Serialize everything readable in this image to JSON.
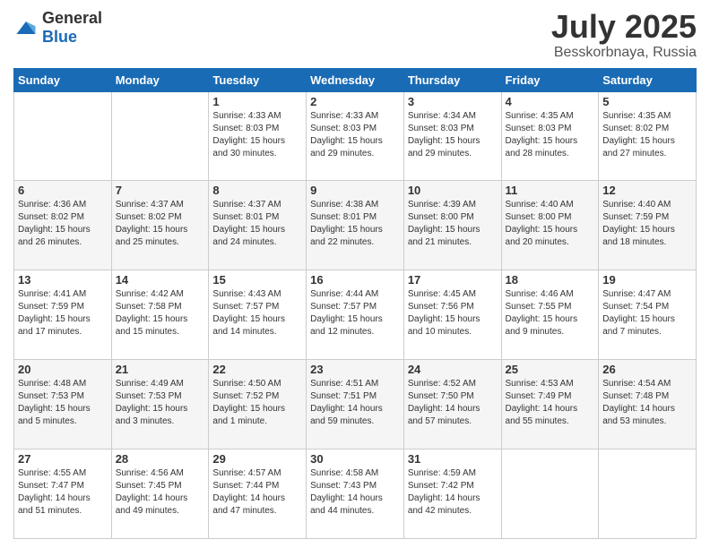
{
  "header": {
    "logo_general": "General",
    "logo_blue": "Blue",
    "title": "July 2025",
    "subtitle": "Besskorbnaya, Russia"
  },
  "weekdays": [
    "Sunday",
    "Monday",
    "Tuesday",
    "Wednesday",
    "Thursday",
    "Friday",
    "Saturday"
  ],
  "weeks": [
    [
      {
        "day": "",
        "info": ""
      },
      {
        "day": "",
        "info": ""
      },
      {
        "day": "1",
        "info": "Sunrise: 4:33 AM\nSunset: 8:03 PM\nDaylight: 15 hours\nand 30 minutes."
      },
      {
        "day": "2",
        "info": "Sunrise: 4:33 AM\nSunset: 8:03 PM\nDaylight: 15 hours\nand 29 minutes."
      },
      {
        "day": "3",
        "info": "Sunrise: 4:34 AM\nSunset: 8:03 PM\nDaylight: 15 hours\nand 29 minutes."
      },
      {
        "day": "4",
        "info": "Sunrise: 4:35 AM\nSunset: 8:03 PM\nDaylight: 15 hours\nand 28 minutes."
      },
      {
        "day": "5",
        "info": "Sunrise: 4:35 AM\nSunset: 8:02 PM\nDaylight: 15 hours\nand 27 minutes."
      }
    ],
    [
      {
        "day": "6",
        "info": "Sunrise: 4:36 AM\nSunset: 8:02 PM\nDaylight: 15 hours\nand 26 minutes."
      },
      {
        "day": "7",
        "info": "Sunrise: 4:37 AM\nSunset: 8:02 PM\nDaylight: 15 hours\nand 25 minutes."
      },
      {
        "day": "8",
        "info": "Sunrise: 4:37 AM\nSunset: 8:01 PM\nDaylight: 15 hours\nand 24 minutes."
      },
      {
        "day": "9",
        "info": "Sunrise: 4:38 AM\nSunset: 8:01 PM\nDaylight: 15 hours\nand 22 minutes."
      },
      {
        "day": "10",
        "info": "Sunrise: 4:39 AM\nSunset: 8:00 PM\nDaylight: 15 hours\nand 21 minutes."
      },
      {
        "day": "11",
        "info": "Sunrise: 4:40 AM\nSunset: 8:00 PM\nDaylight: 15 hours\nand 20 minutes."
      },
      {
        "day": "12",
        "info": "Sunrise: 4:40 AM\nSunset: 7:59 PM\nDaylight: 15 hours\nand 18 minutes."
      }
    ],
    [
      {
        "day": "13",
        "info": "Sunrise: 4:41 AM\nSunset: 7:59 PM\nDaylight: 15 hours\nand 17 minutes."
      },
      {
        "day": "14",
        "info": "Sunrise: 4:42 AM\nSunset: 7:58 PM\nDaylight: 15 hours\nand 15 minutes."
      },
      {
        "day": "15",
        "info": "Sunrise: 4:43 AM\nSunset: 7:57 PM\nDaylight: 15 hours\nand 14 minutes."
      },
      {
        "day": "16",
        "info": "Sunrise: 4:44 AM\nSunset: 7:57 PM\nDaylight: 15 hours\nand 12 minutes."
      },
      {
        "day": "17",
        "info": "Sunrise: 4:45 AM\nSunset: 7:56 PM\nDaylight: 15 hours\nand 10 minutes."
      },
      {
        "day": "18",
        "info": "Sunrise: 4:46 AM\nSunset: 7:55 PM\nDaylight: 15 hours\nand 9 minutes."
      },
      {
        "day": "19",
        "info": "Sunrise: 4:47 AM\nSunset: 7:54 PM\nDaylight: 15 hours\nand 7 minutes."
      }
    ],
    [
      {
        "day": "20",
        "info": "Sunrise: 4:48 AM\nSunset: 7:53 PM\nDaylight: 15 hours\nand 5 minutes."
      },
      {
        "day": "21",
        "info": "Sunrise: 4:49 AM\nSunset: 7:53 PM\nDaylight: 15 hours\nand 3 minutes."
      },
      {
        "day": "22",
        "info": "Sunrise: 4:50 AM\nSunset: 7:52 PM\nDaylight: 15 hours\nand 1 minute."
      },
      {
        "day": "23",
        "info": "Sunrise: 4:51 AM\nSunset: 7:51 PM\nDaylight: 14 hours\nand 59 minutes."
      },
      {
        "day": "24",
        "info": "Sunrise: 4:52 AM\nSunset: 7:50 PM\nDaylight: 14 hours\nand 57 minutes."
      },
      {
        "day": "25",
        "info": "Sunrise: 4:53 AM\nSunset: 7:49 PM\nDaylight: 14 hours\nand 55 minutes."
      },
      {
        "day": "26",
        "info": "Sunrise: 4:54 AM\nSunset: 7:48 PM\nDaylight: 14 hours\nand 53 minutes."
      }
    ],
    [
      {
        "day": "27",
        "info": "Sunrise: 4:55 AM\nSunset: 7:47 PM\nDaylight: 14 hours\nand 51 minutes."
      },
      {
        "day": "28",
        "info": "Sunrise: 4:56 AM\nSunset: 7:45 PM\nDaylight: 14 hours\nand 49 minutes."
      },
      {
        "day": "29",
        "info": "Sunrise: 4:57 AM\nSunset: 7:44 PM\nDaylight: 14 hours\nand 47 minutes."
      },
      {
        "day": "30",
        "info": "Sunrise: 4:58 AM\nSunset: 7:43 PM\nDaylight: 14 hours\nand 44 minutes."
      },
      {
        "day": "31",
        "info": "Sunrise: 4:59 AM\nSunset: 7:42 PM\nDaylight: 14 hours\nand 42 minutes."
      },
      {
        "day": "",
        "info": ""
      },
      {
        "day": "",
        "info": ""
      }
    ]
  ]
}
